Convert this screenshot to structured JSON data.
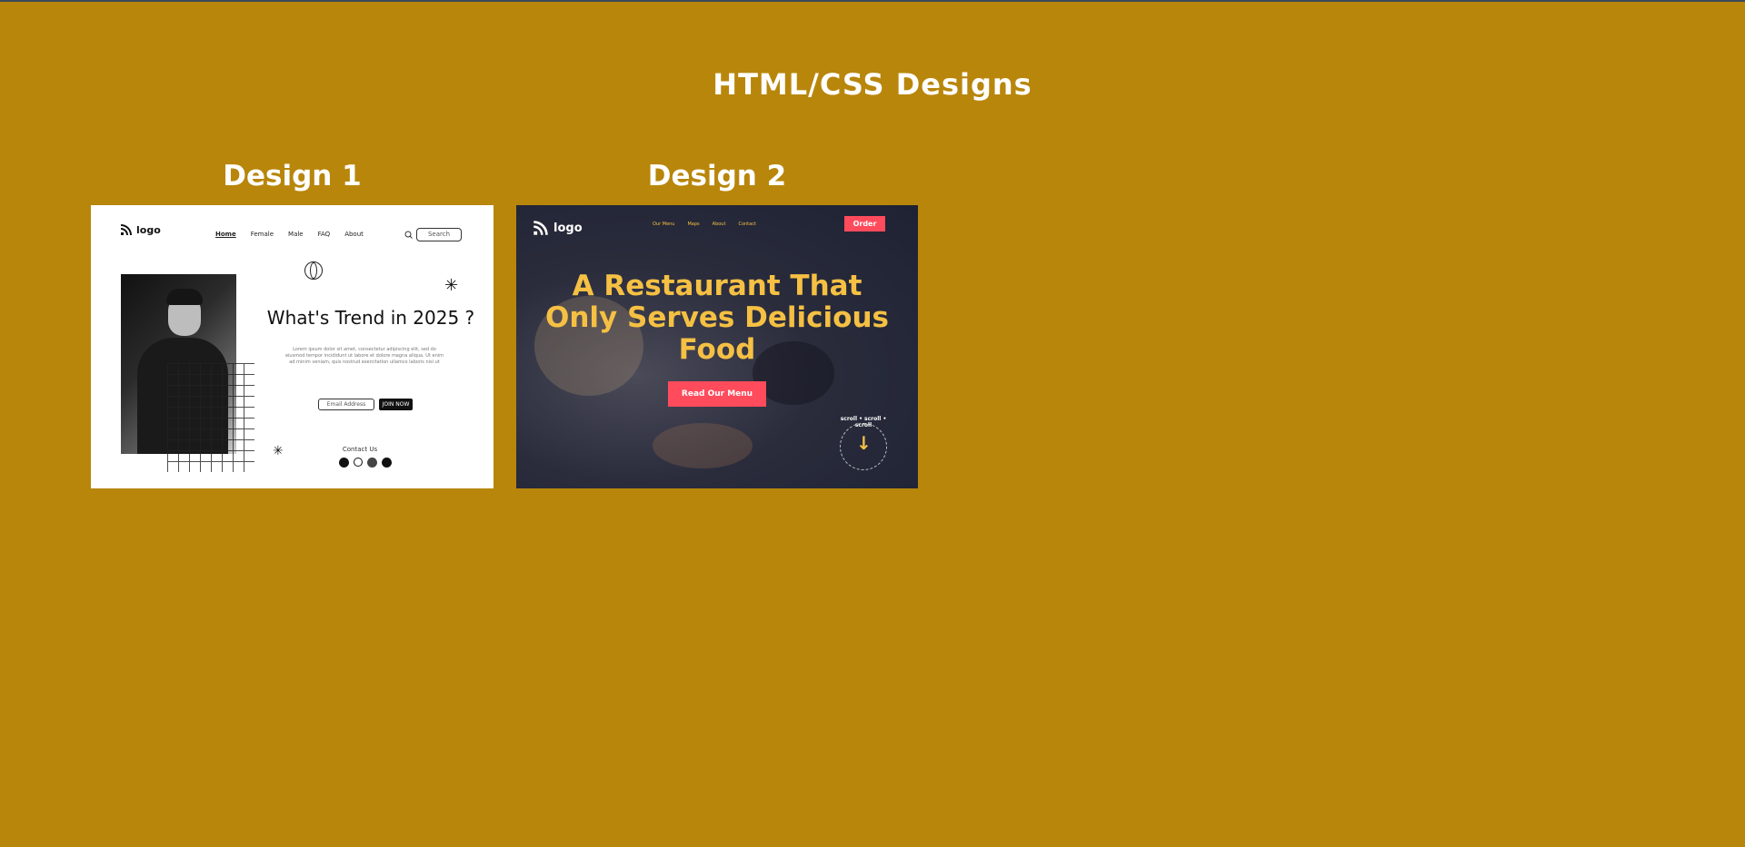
{
  "page": {
    "title": "HTML/CSS Designs",
    "background": "#b8860b"
  },
  "designs": [
    {
      "heading": "Design 1",
      "preview": {
        "logo_text": "logo",
        "nav": [
          "Home",
          "Female",
          "Male",
          "FAQ",
          "About"
        ],
        "search_placeholder": "Search",
        "headline": "What's Trend in 2025 ?",
        "paragraph": "Lorem ipsum dolor sit amet, consectetur adipiscing elit, sed do eiusmod tempor incididunt ut labore et dolore magna aliqua. Ut enim ad minim veniam, quis nostrud exercitation ullamco laboris nisi ut",
        "email_placeholder": "Email Address",
        "join_label": "JOIN NOW",
        "contact_label": "Contact Us",
        "socials": [
          "facebook-icon",
          "messenger-icon",
          "instagram-icon",
          "threads-icon"
        ]
      }
    },
    {
      "heading": "Design 2",
      "preview": {
        "logo_text": "logo",
        "nav": [
          "Our Menu",
          "Maps",
          "About",
          "Contact"
        ],
        "order_label": "Order",
        "headline": "A Restaurant That Only Serves Delicious Food",
        "cta_label": "Read Our Menu",
        "scroll_label": "scroll • scroll • scroll",
        "accent": "#f5c043",
        "button_color": "#ff4b5c"
      }
    }
  ]
}
